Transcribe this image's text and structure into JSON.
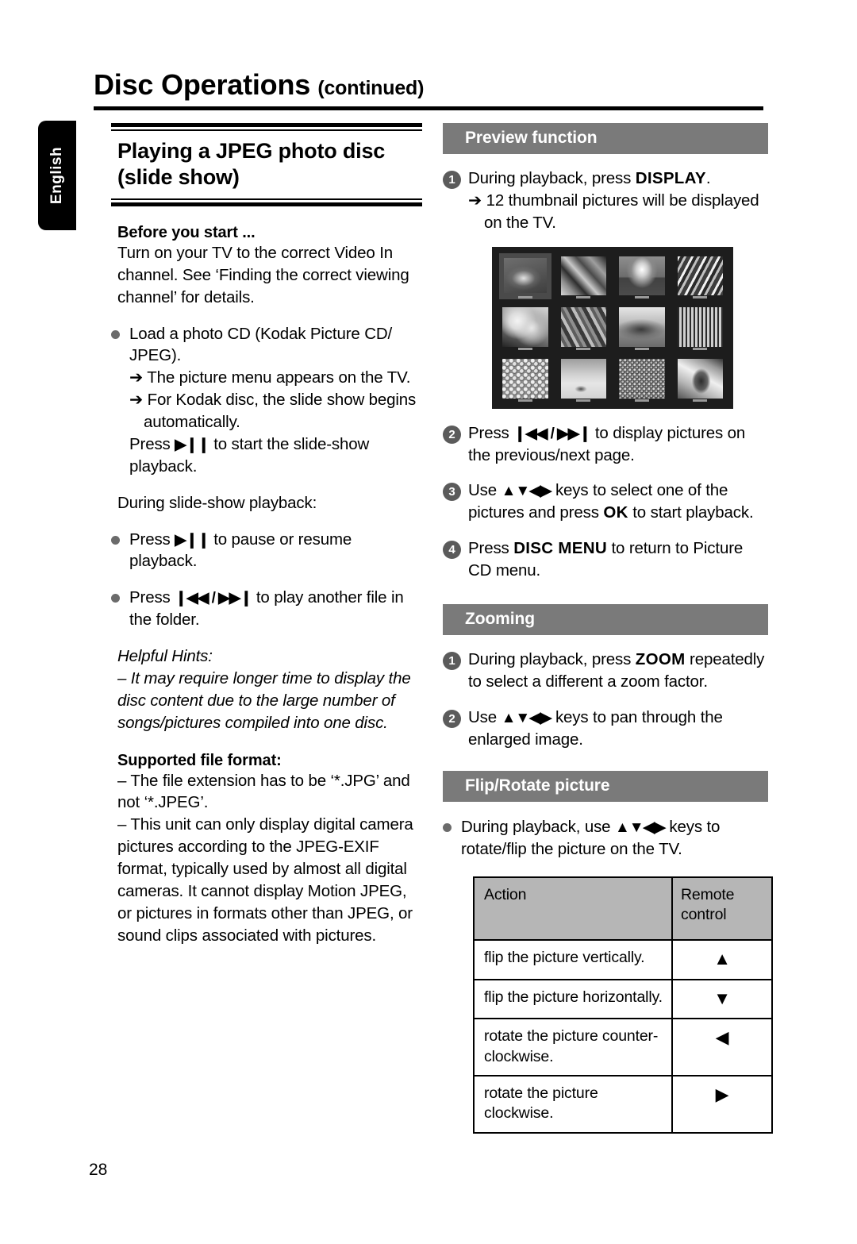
{
  "sidebar": {
    "language_tab": "English"
  },
  "header": {
    "title": "Disc Operations",
    "continued": "(continued)"
  },
  "left_column": {
    "section_title_line1": "Playing a JPEG photo disc",
    "section_title_line2": "(slide show)",
    "before_you_start_heading": "Before you start ...",
    "before_you_start_body": "Turn on your TV to the correct Video In channel. See ‘Finding the correct viewing channel’ for details.",
    "bullets": [
      {
        "text": "Load a photo CD (Kodak Picture CD/ JPEG).",
        "sub": [
          "➔ The picture menu appears on the TV.",
          "➔ For Kodak disc, the slide show begins automatically."
        ],
        "tail_prefix": "Press ",
        "tail_glyph": "▶❙❙",
        "tail_suffix": " to start the slide-show playback."
      }
    ],
    "during_playback_label": "During slide-show playback:",
    "playback_bullets": [
      {
        "prefix": "Press ",
        "glyph": "▶❙❙",
        "suffix": " to pause or resume playback."
      },
      {
        "prefix": "Press ",
        "glyph": "❙◀◀ / ▶▶❙",
        "suffix": " to play another file in the folder."
      }
    ],
    "helpful_hints_heading": "Helpful Hints:",
    "helpful_hints_items": [
      "–  It may require longer time to display the disc content due to the large number of songs/pictures compiled into one disc."
    ],
    "supported_heading": "Supported file format:",
    "supported_items": [
      "–   The file extension has to be ‘*.JPG’ and not ‘*.JPEG’.",
      "–   This unit can only display digital camera pictures according to the JPEG-EXIF format, typically used by almost all digital cameras. It cannot display Motion JPEG, or pictures in formats other than JPEG, or sound clips associated with pictures."
    ]
  },
  "right_column": {
    "preview": {
      "bar_label": "Preview function",
      "steps": [
        {
          "num": "1",
          "prefix": "During playback, press ",
          "keyword": "DISPLAY",
          "suffix": ".",
          "sub": "➔ 12 thumbnail pictures will be displayed on the TV."
        },
        {
          "num": "2",
          "prefix": "Press ",
          "glyph": "❙◀◀ / ▶▶❙",
          "suffix": " to display pictures on the previous/next page."
        },
        {
          "num": "3",
          "prefix": "Use ",
          "glyph": "▲▼◀▶",
          "mid": " keys to select one of the pictures and press ",
          "keyword": "OK",
          "suffix": " to start playback."
        },
        {
          "num": "4",
          "prefix": "Press ",
          "keyword": "DISC MENU",
          "suffix": " to return to Picture CD menu."
        }
      ],
      "tv_screenshot": {
        "caption": "12 thumbnail picture preview screen",
        "rows": 3,
        "columns": 4,
        "selected_index": 0,
        "background": "#1d1d1d"
      }
    },
    "zooming": {
      "bar_label": "Zooming",
      "steps": [
        {
          "num": "1",
          "prefix": "During playback, press ",
          "keyword": "ZOOM",
          "suffix": " repeatedly to select a different a zoom factor."
        },
        {
          "num": "2",
          "prefix": "Use ",
          "glyph": "▲▼◀▶",
          "suffix": " keys to pan through the enlarged image."
        }
      ]
    },
    "flip_rotate": {
      "bar_label": "Flip/Rotate picture",
      "bullet": {
        "prefix": "During playback, use ",
        "glyph": "▲▼◀▶",
        "suffix": " keys to rotate/flip the picture on the TV."
      },
      "table": {
        "headers": [
          "Action",
          "Remote control"
        ],
        "rows": [
          {
            "action": "flip the picture vertically.",
            "key": "▲"
          },
          {
            "action": "flip the picture horizontally.",
            "key": "▼"
          },
          {
            "action": "rotate the picture counter-clockwise.",
            "key": "◀"
          },
          {
            "action": "rotate the picture clockwise.",
            "key": "▶"
          }
        ]
      }
    }
  },
  "footer": {
    "page_number": "28"
  },
  "colors": {
    "bar_gray": "#7a7a7a",
    "table_header_gray": "#b6b6b6",
    "step_circle": "#5b5b5b",
    "bullet_dot": "#6b6b6b",
    "tab_black": "#000000"
  }
}
